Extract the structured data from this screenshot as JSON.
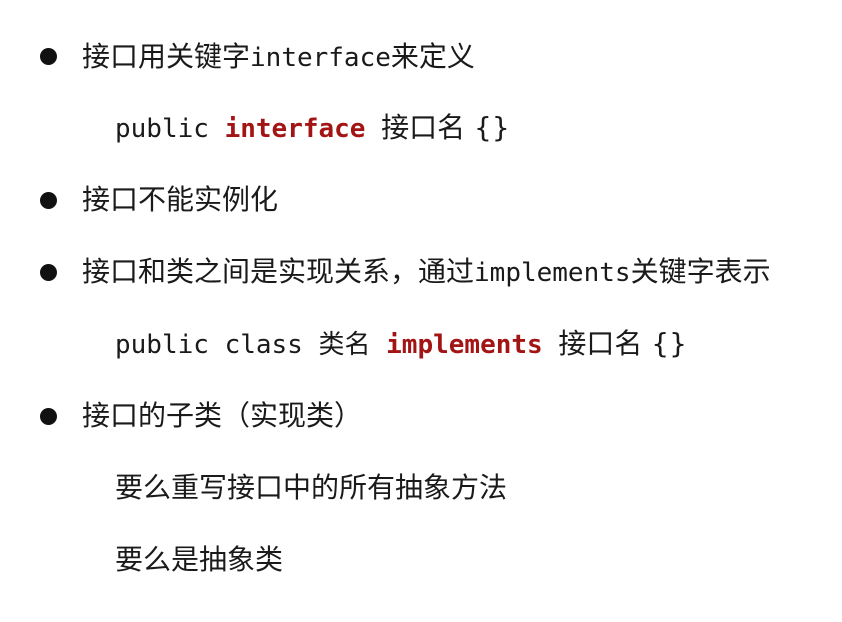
{
  "bullets": [
    {
      "text_prefix": "接口用关键字",
      "code": "interface",
      "text_suffix": "来定义"
    },
    {
      "text": "接口不能实例化"
    },
    {
      "text_prefix": "接口和类之间是实现关系，通过",
      "code": "implements",
      "text_suffix": "关键字表示"
    },
    {
      "text": "接口的子类（实现类）"
    }
  ],
  "code_lines": [
    {
      "pre": "public",
      "keyword": "interface",
      "post": "接口名 {}"
    },
    {
      "pre": "public class 类名",
      "keyword": "implements",
      "post": "接口名 {}"
    }
  ],
  "sub_lines": [
    "要么重写接口中的所有抽象方法",
    "要么是抽象类"
  ],
  "colors": {
    "keyword": "#a31515",
    "text": "#1a1a1a",
    "bullet": "#111111"
  }
}
